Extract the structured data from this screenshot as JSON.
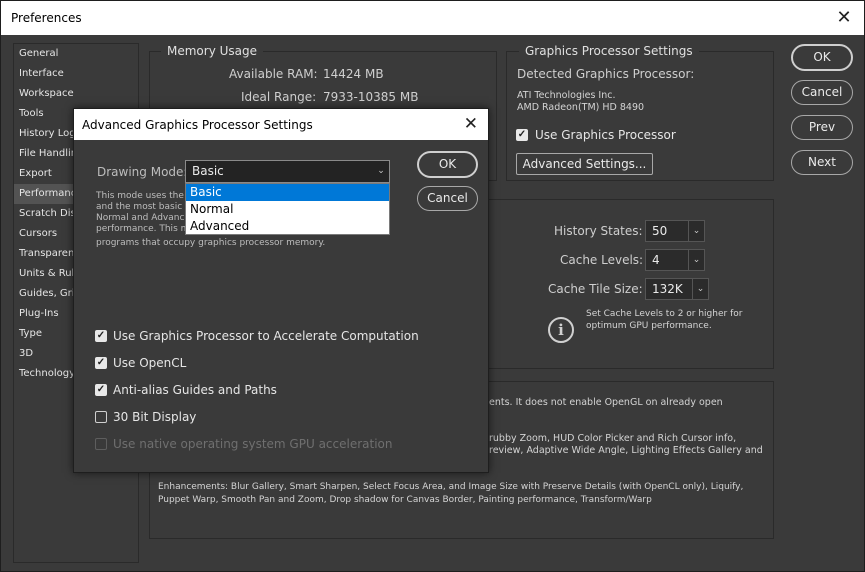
{
  "window": {
    "title": "Preferences",
    "close": "✕"
  },
  "sidebar": {
    "items": [
      {
        "label": "General"
      },
      {
        "label": "Interface"
      },
      {
        "label": "Workspace"
      },
      {
        "label": "Tools"
      },
      {
        "label": "History Log"
      },
      {
        "label": "File Handling"
      },
      {
        "label": "Export"
      },
      {
        "label": "Performance"
      },
      {
        "label": "Scratch Disks"
      },
      {
        "label": "Cursors"
      },
      {
        "label": "Transparency"
      },
      {
        "label": "Units & Rulers"
      },
      {
        "label": "Guides, Grid"
      },
      {
        "label": "Plug-Ins"
      },
      {
        "label": "Type"
      },
      {
        "label": "3D"
      },
      {
        "label": "Technology"
      }
    ]
  },
  "memory": {
    "heading": "Memory Usage",
    "available_label": "Available RAM:",
    "available_value": "14424 MB",
    "ideal_label": "Ideal Range:",
    "ideal_value": "7933-10385 MB"
  },
  "gpu": {
    "heading": "Graphics Processor Settings",
    "detected_label": "Detected Graphics Processor:",
    "vendor": "ATI Technologies Inc.",
    "model": "AMD Radeon(TM) HD 8490",
    "use_label": "Use Graphics Processor",
    "advanced_label": "Advanced Settings..."
  },
  "history": {
    "states_label": "History States:",
    "states_value": "50",
    "levels_label": "Cache Levels:",
    "levels_value": "4",
    "tile_label": "Cache Tile Size:",
    "tile_value": "132K",
    "note": "Set Cache Levels to 2 or higher for optimum GPU performance."
  },
  "desc": {
    "line1": "ents. It does not enable OpenGL on already open",
    "line2": "rubby Zoom, HUD Color Picker and Rich Cursor info,",
    "line3": "review, Adaptive Wide Angle, Lighting Effects Gallery and",
    "enh": "Enhancements: Blur Gallery, Smart Sharpen, Select Focus Area, and Image Size with Preserve Details (with OpenCL only), Liquify, Puppet Warp, Smooth Pan and Zoom, Drop shadow for Canvas Border, Painting performance, Transform/Warp"
  },
  "buttons": {
    "ok": "OK",
    "cancel": "Cancel",
    "prev": "Prev",
    "next": "Next"
  },
  "modal": {
    "title": "Advanced Graphics Processor Settings",
    "drawing_mode_label": "Drawing Mode:",
    "drawing_mode_value": "Basic",
    "options": [
      "Basic",
      "Normal",
      "Advanced"
    ],
    "desc_line1": "This mode uses the",
    "desc_line2": "and the most basic G",
    "desc_line3": "Normal and Advanc",
    "desc_line4": "performance.  This m",
    "desc_line5": "programs that occupy graphics processor memory.",
    "ok": "OK",
    "cancel": "Cancel",
    "checks": [
      {
        "label": "Use Graphics Processor to Accelerate Computation",
        "checked": true
      },
      {
        "label": "Use OpenCL",
        "checked": true
      },
      {
        "label": "Anti-alias Guides and Paths",
        "checked": true
      },
      {
        "label": "30 Bit Display",
        "checked": false
      },
      {
        "label": "Use native operating system GPU acceleration",
        "checked": false
      }
    ]
  },
  "colors": {
    "bg": "#3a3a3a",
    "highlight": "#0078d7",
    "text": "#e6e6e6"
  }
}
